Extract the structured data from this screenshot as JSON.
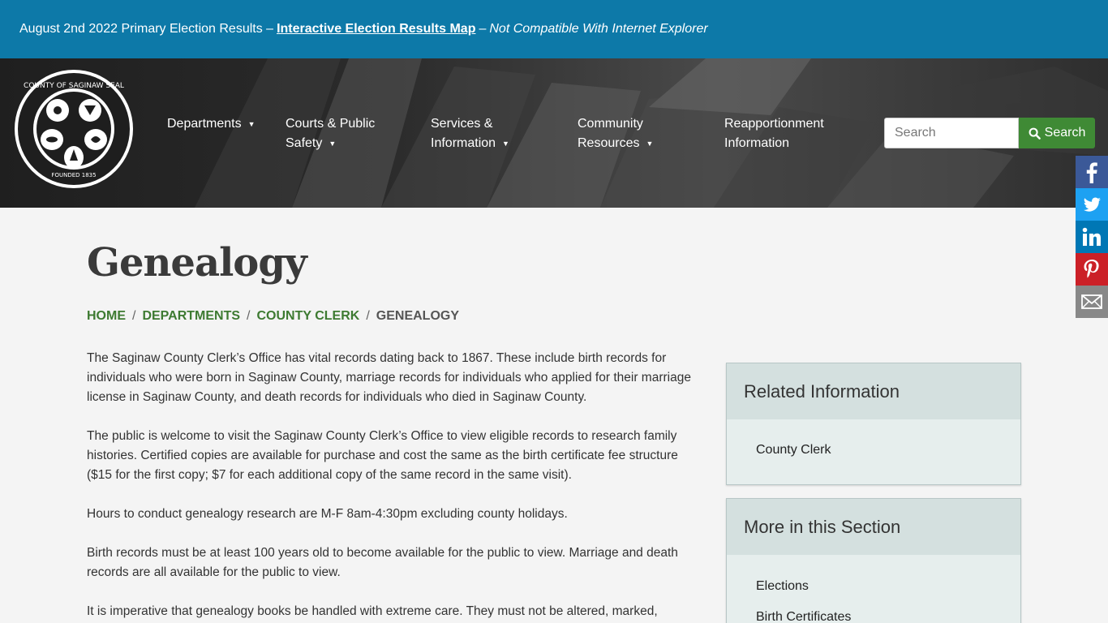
{
  "alert": {
    "text": "August 2nd 2022 Primary Election Results –",
    "link": "Interactive Election Results Map",
    "dash": "–",
    "note": "Not Compatible With Internet Explorer"
  },
  "seal": {
    "top_text": "COUNTY OF SAGINAW SEAL",
    "bottom_text": "FOUNDED 1835"
  },
  "nav": {
    "items": [
      {
        "line1": "Departments",
        "line2": "",
        "has_caret": true
      },
      {
        "line1": "Courts & Public",
        "line2": "Safety",
        "has_caret": true
      },
      {
        "line1": "Services &",
        "line2": "Information",
        "has_caret": true
      },
      {
        "line1": "Community",
        "line2": "Resources",
        "has_caret": true
      },
      {
        "line1": "Reapportionment",
        "line2": "Information",
        "has_caret": false
      }
    ]
  },
  "search": {
    "placeholder": "Search",
    "button_label": "Search"
  },
  "social": [
    "facebook-icon",
    "twitter-icon",
    "linkedin-icon",
    "pinterest-icon",
    "email-icon"
  ],
  "colors": {
    "alert_bg": "#0d79a8",
    "accent_green": "#3f8a35",
    "facebook": "#3b5998",
    "twitter": "#1da1f2",
    "linkedin": "#0077b5",
    "pinterest": "#cb2027",
    "email": "#888888"
  },
  "page": {
    "title": "Genealogy",
    "breadcrumb": [
      "HOME",
      "DEPARTMENTS",
      "COUNTY CLERK",
      "GENEALOGY"
    ],
    "paragraphs": [
      "The Saginaw County Clerk’s Office has vital records dating back to 1867.  These include birth records for individuals who were born in Saginaw County, marriage records for individuals who applied for their marriage license in Saginaw County, and death records for individuals who died in Saginaw County.",
      "The public is welcome to visit the Saginaw County Clerk’s Office to view eligible records to research family histories.  Certified copies are available for purchase and cost the same as the birth certificate fee structure ($15 for the first copy; $7 for each additional copy of the same record in the same visit).",
      "Hours to conduct genealogy research are M-F 8am-4:30pm excluding county holidays.",
      "Birth records must be at least 100 years old to become available for the public to view.  Marriage and death records are all available for the public to view.",
      "It is imperative that genealogy books be handled with extreme care.  They must not be altered, marked,"
    ]
  },
  "sidebar": {
    "related": {
      "title": "Related Information",
      "items": [
        "County Clerk"
      ]
    },
    "more": {
      "title": "More in this Section",
      "items": [
        "Elections",
        "Birth Certificates"
      ]
    }
  }
}
